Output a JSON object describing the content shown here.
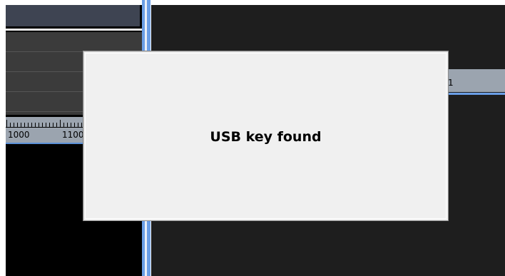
{
  "left_panel": {
    "ruler": {
      "labels": [
        "1000",
        "1100"
      ]
    },
    "track_count": 4
  },
  "right_panel": {
    "ruler": {
      "label": "1"
    }
  },
  "dialog": {
    "message": "USB key found"
  },
  "colors": {
    "ruler_bg": "#9ba4af",
    "splitter_blue": "#6a9ee6",
    "dialog_bg": "#f0f0f0",
    "panel_dark": "#1e1e1e"
  }
}
